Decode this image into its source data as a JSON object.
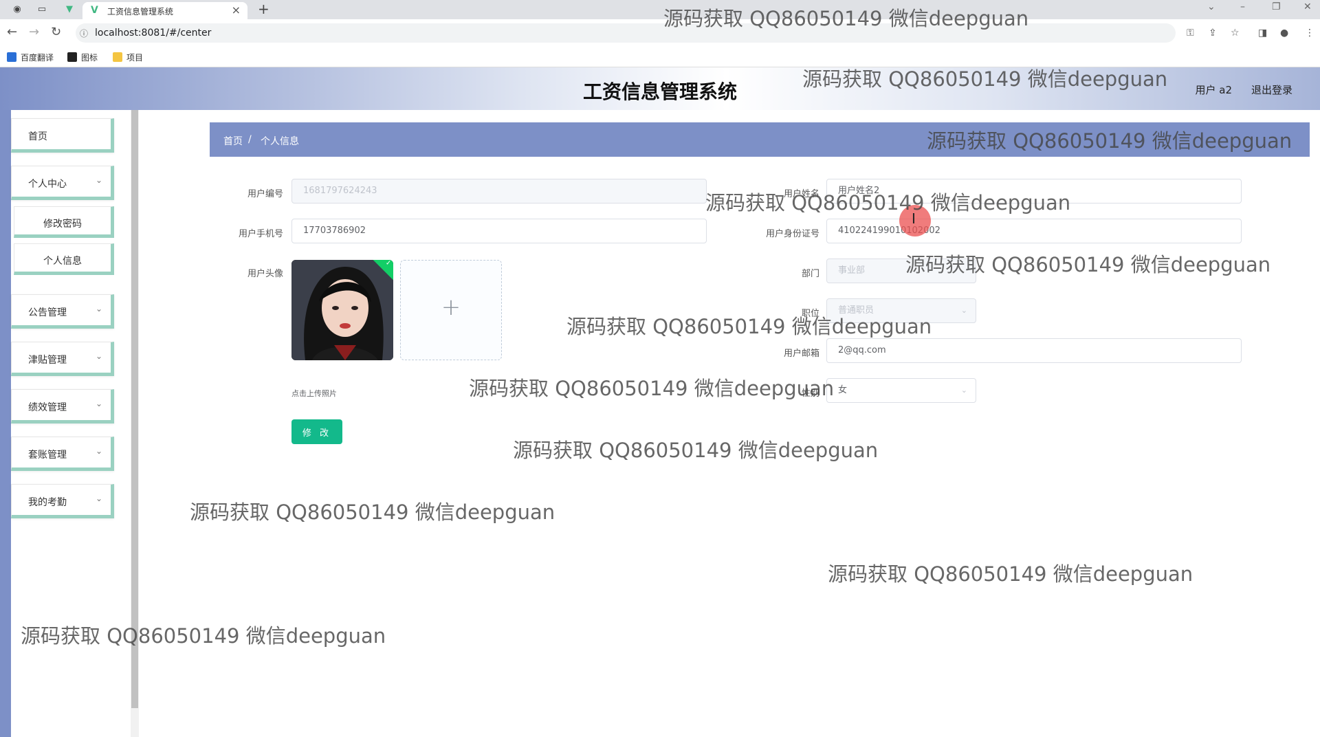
{
  "browser": {
    "tab_title": "工资信息管理系统",
    "url": "localhost:8081/#/center",
    "bookmarks": [
      "百度翻译",
      "图标",
      "项目"
    ]
  },
  "header": {
    "title": "工资信息管理系统",
    "user_label": "用户 a2",
    "logout": "退出登录"
  },
  "sidebar": {
    "items": [
      {
        "label": "首页"
      },
      {
        "label": "个人中心"
      },
      {
        "label": "修改密码"
      },
      {
        "label": "个人信息"
      },
      {
        "label": "公告管理"
      },
      {
        "label": "津贴管理"
      },
      {
        "label": "绩效管理"
      },
      {
        "label": "套账管理"
      },
      {
        "label": "我的考勤"
      }
    ]
  },
  "breadcrumb": {
    "home": "首页",
    "sep": "/",
    "current": "个人信息"
  },
  "form": {
    "user_no_label": "用户编号",
    "user_no_value": "1681797624243",
    "user_name_label": "用户姓名",
    "user_name_value": "用户姓名2",
    "phone_label": "用户手机号",
    "phone_value": "17703786902",
    "idcard_label": "用户身份证号",
    "idcard_value": "410224199010102002",
    "avatar_label": "用户头像",
    "upload_plus": "+",
    "upload_tip": "点击上传照片",
    "dept_label": "部门",
    "dept_value": "事业部",
    "position_label": "职位",
    "position_value": "普通职员",
    "email_label": "用户邮箱",
    "email_value": "2@qq.com",
    "gender_label": "性别",
    "gender_value": "女",
    "submit_label": "修 改"
  },
  "watermark": "源码获取 QQ86050149 微信deepguan"
}
